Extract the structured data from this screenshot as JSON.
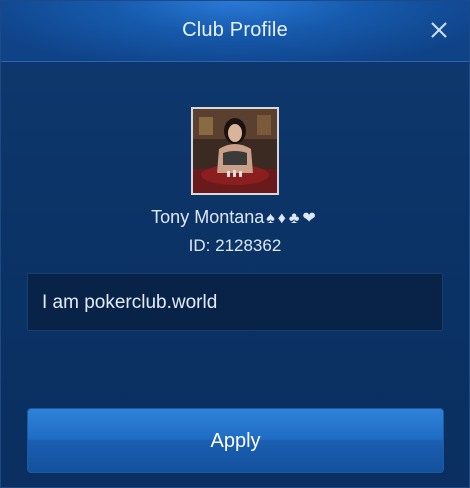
{
  "dialog": {
    "title": "Club Profile",
    "close_icon": "close-icon"
  },
  "profile": {
    "avatar": "avatar",
    "name": "Tony Montana",
    "suits": "♠♦♣❤",
    "id_text": "ID: 2128362"
  },
  "bio": {
    "value": "I am pokerclub.world"
  },
  "actions": {
    "apply_label": "Apply"
  },
  "colors": {
    "header": "#165aac",
    "body": "#0c3468",
    "button": "#1f6cc4",
    "text": "#dfe8f6"
  }
}
